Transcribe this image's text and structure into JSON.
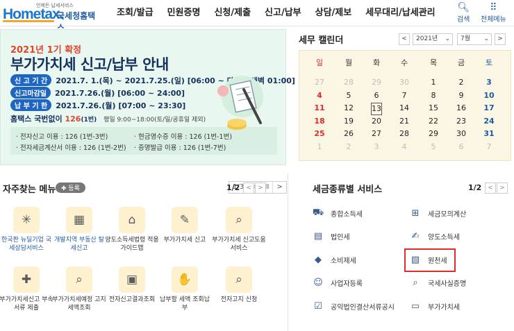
{
  "header": {
    "logo_tagline": "언제든 납세서비스",
    "logo_brand": "Hometax.",
    "logo_sub": "국세청홈택스",
    "nav": [
      "조회/발급",
      "민원증명",
      "신청/제출",
      "신고/납부",
      "상담/제보",
      "세무대리/납세관리"
    ],
    "search_label": "검색",
    "menu_label": "전체메뉴"
  },
  "banner": {
    "year": "2021년 1기 확정",
    "title": "부가가치세 신고/납부 안내",
    "rows": [
      {
        "pill": "신 고 기 간",
        "text": "2021.7. 1.(목) ~ 2021.7.25.(일) [06:00 ~ 다음날 새벽 01:00]"
      },
      {
        "pill": "신고마감일",
        "text": "2021.7.26.(월) [06:00 ~ 24:00]"
      },
      {
        "pill": "납 부 기 한",
        "text": "2021.7.26.(월) [07:00 ~ 23:30]"
      }
    ],
    "tax_pre": "홈택스 국번없이 ",
    "tax_num": "126",
    "tax_post": "(1번)",
    "tax_hours": "평일 9:00~18:00(토/일/공휴일 제외)",
    "items": [
      "· 전자신고 이용 : 126 (1번-3번)",
      "· 현금영수증 이용 : 126 (1번-1번)",
      "· 전자세금계산서 이용 : 126 (1번-2번)",
      "· 증명발급 이용 : 126 (1번-7번)"
    ],
    "pager": {
      "page": "1/3",
      "prev": "<",
      "pause": "II",
      "next": ">"
    }
  },
  "calendar": {
    "title": "세무 캘린더",
    "year": "2021년",
    "month": "7월",
    "weekdays": [
      "일",
      "월",
      "화",
      "수",
      "목",
      "금",
      "토"
    ],
    "days": [
      [
        "27",
        "28",
        "29",
        "30",
        "1",
        "2",
        "3"
      ],
      [
        "4",
        "5",
        "6",
        "7",
        "8",
        "9",
        "10"
      ],
      [
        "11",
        "12",
        "13",
        "14",
        "15",
        "16",
        "17"
      ],
      [
        "18",
        "19",
        "20",
        "21",
        "22",
        "23",
        "24"
      ],
      [
        "25",
        "26",
        "27",
        "28",
        "29",
        "30",
        "31"
      ],
      [
        "1",
        "2",
        "3",
        "4",
        "5",
        "6",
        "7"
      ]
    ],
    "today": "13"
  },
  "favorites": {
    "title": "자주찾는 메뉴",
    "register": "등록",
    "page": "1/2",
    "items": [
      {
        "label": "한국판 뉴딜기업 국세상담서비스",
        "icon": "sparkle-icon",
        "glyph": "✳"
      },
      {
        "label": "개발지역 부동산 탈세신고",
        "icon": "building-icon",
        "glyph": "▦"
      },
      {
        "label": "양도소득세법령 적용가이드맵",
        "icon": "house-icon",
        "glyph": "⌂"
      },
      {
        "label": "부가가치세 신고",
        "icon": "vat-doc-icon",
        "glyph": "✎"
      },
      {
        "label": "부가가치세 신고도움 서비스",
        "icon": "document-search-icon",
        "glyph": "⌕"
      },
      {
        "label": "부가가치세신고 부속서류 제출",
        "icon": "doc-add-icon",
        "glyph": "✚"
      },
      {
        "label": "부가가치세예정 고지세액조회",
        "icon": "doc-search-icon",
        "glyph": "⌕"
      },
      {
        "label": "전자신고결과조회",
        "icon": "monitor-search-icon",
        "glyph": "▣"
      },
      {
        "label": "납부할 세액 조회납부",
        "icon": "money-hand-icon",
        "glyph": "✋"
      },
      {
        "label": "전자고지 신청",
        "icon": "notice-search-icon",
        "glyph": "⌕"
      }
    ]
  },
  "taxservices": {
    "title": "세금종류별 서비스",
    "page": "1/2",
    "items": [
      {
        "label": "종합소득세",
        "icon": "car-money-icon",
        "glyph": "⛟"
      },
      {
        "label": "세금모의계산",
        "icon": "calculator-icon",
        "glyph": "⊞"
      },
      {
        "label": "법인세",
        "icon": "building-icon",
        "glyph": "▤"
      },
      {
        "label": "양도소득세",
        "icon": "doc-pen-icon",
        "glyph": "✍"
      },
      {
        "label": "소비제세",
        "icon": "gem-icon",
        "glyph": "◆"
      },
      {
        "label": "원천세",
        "icon": "tax-receipt-icon",
        "glyph": "▧"
      },
      {
        "label": "사업자등록",
        "icon": "person-icon",
        "glyph": "☺"
      },
      {
        "label": "국세사실증명",
        "icon": "certificate-search-icon",
        "glyph": "⌕"
      },
      {
        "label": "공익법인결산서류공시",
        "icon": "clipboard-check-icon",
        "glyph": "☑"
      },
      {
        "label": "부가가치세",
        "icon": "vat-icon",
        "glyph": "▭"
      }
    ]
  }
}
